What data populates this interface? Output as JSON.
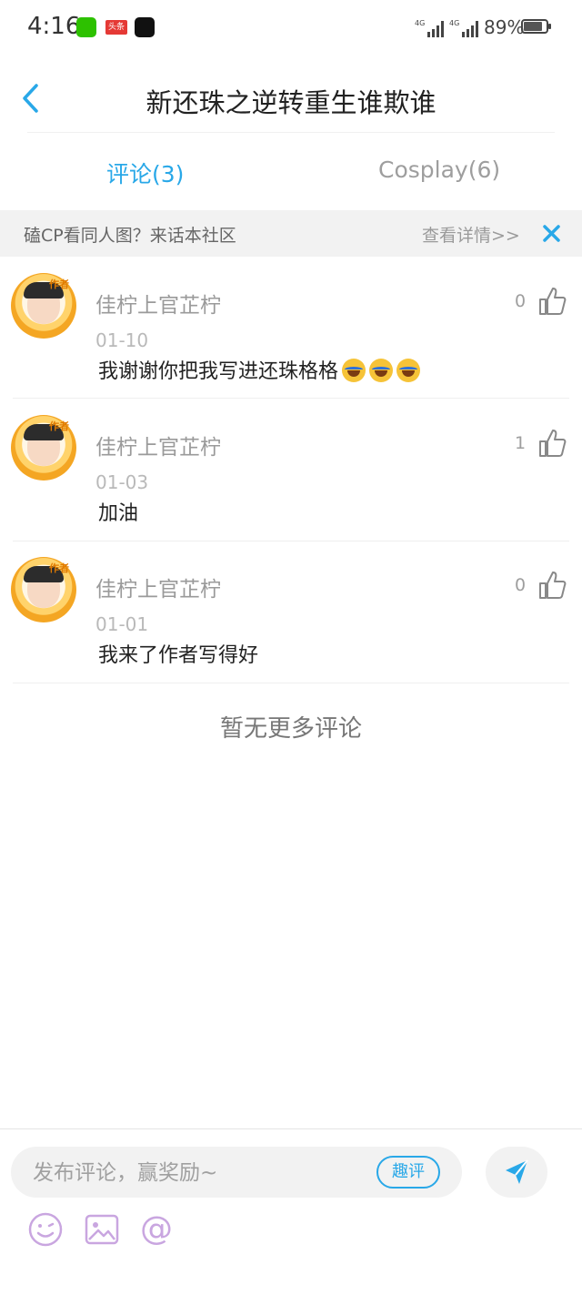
{
  "status_bar": {
    "time": "4:16",
    "toutiao_label": "头条",
    "network_1": "4G",
    "network_2": "4G",
    "battery_text": "89%",
    "battery_level": 0.89
  },
  "header": {
    "title": "新还珠之逆转重生谁欺谁",
    "back_icon": "chevron-left-icon"
  },
  "tabs": [
    {
      "label": "评论(3)",
      "active": true
    },
    {
      "label": "Cosplay(6)",
      "active": false
    }
  ],
  "banner": {
    "text": "磕CP看同人图？来话本社区",
    "link": "查看详情>>",
    "close_icon": "close-icon"
  },
  "comments": [
    {
      "author": "佳柠上官芷柠",
      "date": "01-10",
      "text": "我谢谢你把我写进还珠格格",
      "emoji_count": 3,
      "likes": "0",
      "avatar_badge": "作者"
    },
    {
      "author": "佳柠上官芷柠",
      "date": "01-03",
      "text": "加油",
      "emoji_count": 0,
      "likes": "1",
      "avatar_badge": "作者"
    },
    {
      "author": "佳柠上官芷柠",
      "date": "01-01",
      "text": "我来了作者写得好",
      "emoji_count": 0,
      "likes": "0",
      "avatar_badge": "作者"
    }
  ],
  "no_more": "暂无更多评论",
  "composer": {
    "placeholder": "发布评论，赢奖励~",
    "value": "",
    "quping_label": "趣评",
    "send_icon": "send-icon",
    "tools": [
      "emoji-icon",
      "image-icon",
      "at-icon"
    ]
  },
  "colors": {
    "accent": "#29a8e8",
    "tool_purple": "#c9a6e0"
  }
}
